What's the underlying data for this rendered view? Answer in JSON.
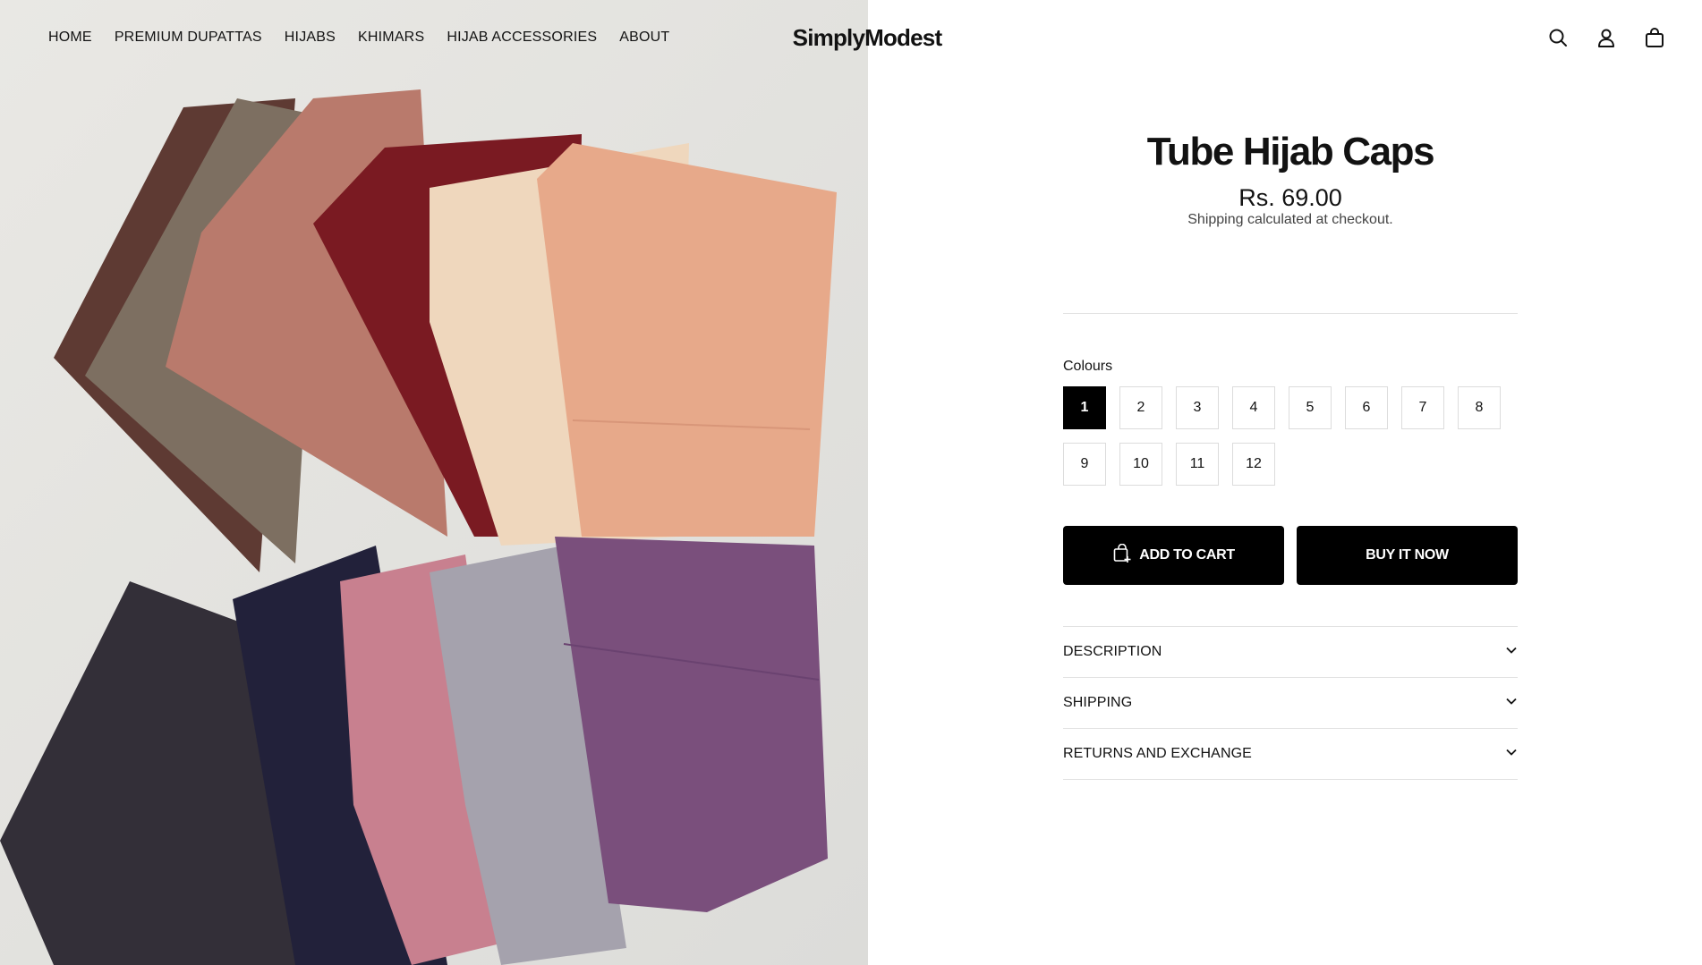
{
  "header": {
    "nav": [
      "HOME",
      "PREMIUM DUPATTAS",
      "HIJABS",
      "KHIMARS",
      "HIJAB ACCESSORIES",
      "ABOUT"
    ],
    "logo": "SimplyModest",
    "icons": [
      "search-icon",
      "account-icon",
      "cart-icon"
    ]
  },
  "product": {
    "title": "Tube Hijab Caps",
    "price": "Rs. 69.00",
    "shipping_note": "Shipping calculated at checkout.",
    "option_label": "Colours",
    "options": [
      "1",
      "2",
      "3",
      "4",
      "5",
      "6",
      "7",
      "8",
      "9",
      "10",
      "11",
      "12"
    ],
    "selected_option": "1",
    "add_to_cart": "ADD TO CART",
    "buy_now": "BUY IT NOW",
    "accordion": [
      "DESCRIPTION",
      "SHIPPING",
      "RETURNS AND EXCHANGE"
    ]
  },
  "colors": {
    "text": "#121212",
    "button": "#000000",
    "border": "#e2e2e2",
    "background": "#ffffff"
  }
}
